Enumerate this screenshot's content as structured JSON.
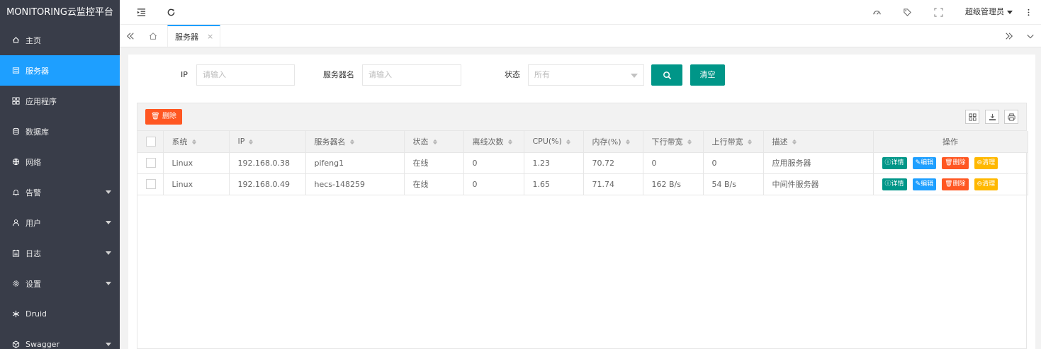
{
  "app": {
    "title": "MONITORING云监控平台"
  },
  "sidebar": {
    "items": [
      {
        "label": "主页",
        "icon": "home-icon",
        "active": false,
        "has_arrow": false
      },
      {
        "label": "服务器",
        "icon": "server-icon",
        "active": true,
        "has_arrow": false
      },
      {
        "label": "应用程序",
        "icon": "app-icon",
        "active": false,
        "has_arrow": false
      },
      {
        "label": "数据库",
        "icon": "database-icon",
        "active": false,
        "has_arrow": false
      },
      {
        "label": "网络",
        "icon": "network-icon",
        "active": false,
        "has_arrow": false
      },
      {
        "label": "告警",
        "icon": "bell-icon",
        "active": false,
        "has_arrow": true
      },
      {
        "label": "用户",
        "icon": "user-icon",
        "active": false,
        "has_arrow": true
      },
      {
        "label": "日志",
        "icon": "log-icon",
        "active": false,
        "has_arrow": true
      },
      {
        "label": "设置",
        "icon": "gear-icon",
        "active": false,
        "has_arrow": true
      },
      {
        "label": "Druid",
        "icon": "druid-icon",
        "active": false,
        "has_arrow": false
      },
      {
        "label": "Swagger",
        "icon": "swagger-icon",
        "active": false,
        "has_arrow": true
      }
    ]
  },
  "header": {
    "user": "超级管理员"
  },
  "tabs": {
    "current": "服务器",
    "close": "×"
  },
  "search": {
    "ip_label": "IP",
    "ip_placeholder": "请输入",
    "name_label": "服务器名",
    "name_placeholder": "请输入",
    "status_label": "状态",
    "status_value": "所有",
    "clear_label": "清空"
  },
  "table": {
    "delete_label": "删除",
    "columns": [
      "系统",
      "IP",
      "服务器名",
      "状态",
      "离线次数",
      "CPU(%)",
      "内存(%)",
      "下行带宽",
      "上行带宽",
      "描述"
    ],
    "op_header": "操作",
    "rows": [
      [
        "Linux",
        "192.168.0.38",
        "pifeng1",
        "在线",
        "0",
        "1.23",
        "70.72",
        "0",
        "0",
        "应用服务器"
      ],
      [
        "Linux",
        "192.168.0.49",
        "hecs-148259",
        "在线",
        "0",
        "1.65",
        "71.74",
        "162 B/s",
        "54 B/s",
        "中间件服务器"
      ]
    ],
    "ops": {
      "detail": "详情",
      "edit": "编辑",
      "delete": "删除",
      "clean": "清理"
    }
  },
  "colors": {
    "sidebar_bg": "#393D49",
    "active": "#1E9FFF",
    "primary": "#009688",
    "danger": "#FF5722",
    "warn": "#FFB800"
  }
}
